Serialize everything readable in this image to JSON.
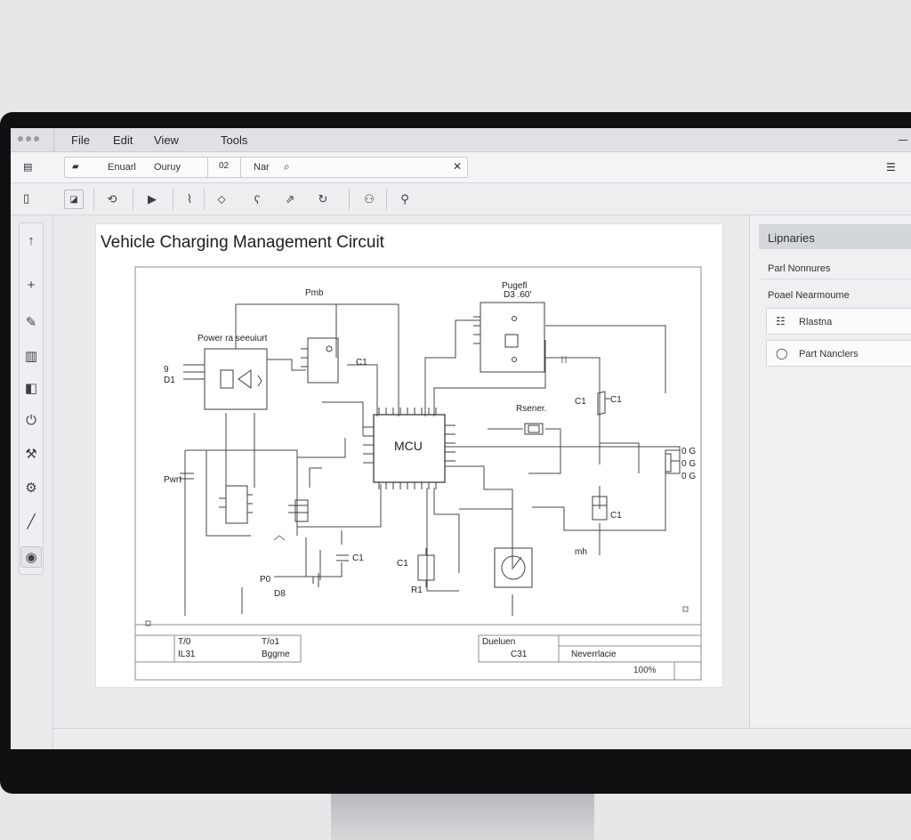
{
  "menu": {
    "file": "File",
    "edit": "Edit",
    "view": "View",
    "tools": "Tools"
  },
  "addressbar": {
    "label1": "Enuarl",
    "label2": "Ouruy",
    "box": "02",
    "label3": "Nar"
  },
  "toolbar_icons": [
    "select-icon",
    "rotate-icon",
    "place-icon",
    "wire-icon",
    "erase-icon",
    "probe-icon",
    "export-icon",
    "refresh-icon",
    "user-icon",
    "pin-icon"
  ],
  "sidebar_icons": [
    "arrow-icon",
    "plus-icon",
    "pencil-icon",
    "layers-icon",
    "square-icon",
    "power-icon",
    "wrench-icon",
    "gear-icon",
    "line-icon",
    "record-icon"
  ],
  "sheet": {
    "title": "Vehicle Charging Management Circuit",
    "labels": {
      "pmb": "Pmb",
      "power_regulator": "Power ra seeuiurt",
      "top_right": "Pugefl\nD3 .60'",
      "c1_a": "C1",
      "c1_b": "C1",
      "c1_c": "C1",
      "c1_d": "C1",
      "c1_e": "C1",
      "c1_f": "C1",
      "mcu": "MCU",
      "resistor": "Rsener.",
      "left_pin": "9\nD1",
      "pwr": "Pwrt",
      "bottom_p": "P0",
      "bottom_d": "D8",
      "right_conn": "0 G\n0 G\n0 G",
      "mh": "mh",
      "r1": "R1"
    },
    "title_block": {
      "c1r1": "T/0",
      "c1r2": "IL31",
      "c2r1": "T/o1",
      "c2r2": "Bggme",
      "c3r1": "Dueluen",
      "c3r2": "C31",
      "c4r2": "Neverrlacie"
    }
  },
  "zoom": "100%",
  "libraries": {
    "title": "Lipnaries",
    "row1": "Parl Nonnures",
    "row2": "Poael Nearmoume",
    "items": [
      {
        "icon": "list-icon",
        "label": "Rlastna"
      },
      {
        "icon": "search-icon",
        "label": "Part Nanclers"
      }
    ]
  }
}
